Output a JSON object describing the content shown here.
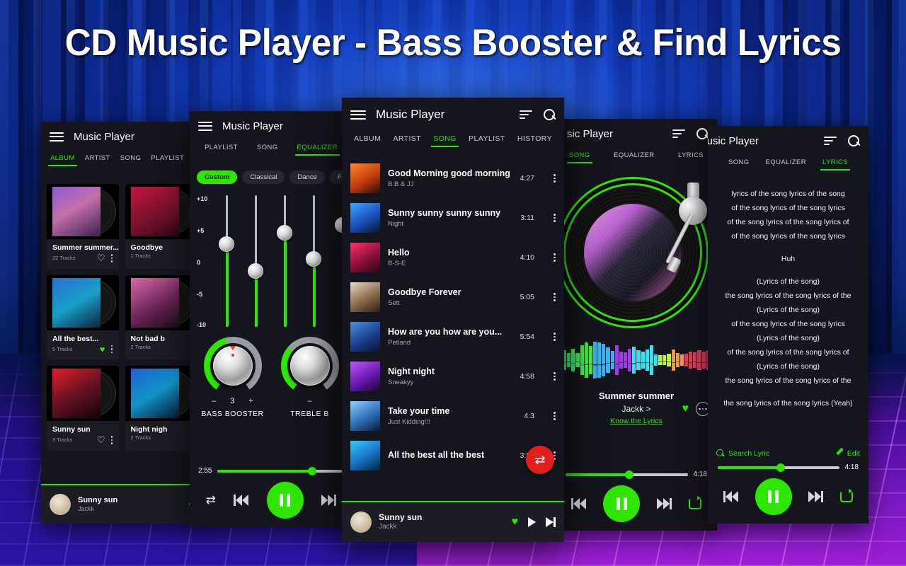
{
  "banner": {
    "title": "CD Music Player - Bass Booster & Find Lyrics"
  },
  "colors": {
    "accent": "#2ee600",
    "fab": "#e31e1e",
    "panel": "#15161d",
    "card": "#1b1c24"
  },
  "app": {
    "title": "Music Player"
  },
  "phone_album": {
    "title": "Music Player",
    "tabs": [
      {
        "label": "ALBUM",
        "active": true
      },
      {
        "label": "ARTIST",
        "active": false
      },
      {
        "label": "SONG",
        "active": false
      },
      {
        "label": "PLAYLIST",
        "active": false
      }
    ],
    "albums": [
      {
        "name": "Summer summer...",
        "tracks": "22 Tracks",
        "liked": false
      },
      {
        "name": "Goodbye",
        "tracks": "1 Tracks",
        "liked": false
      },
      {
        "name": "All the best...",
        "tracks": "5 Tracks",
        "liked": true
      },
      {
        "name": "Not bad b",
        "tracks": "2 Tracks",
        "liked": false
      },
      {
        "name": "Sunny sun",
        "tracks": "3 Tracks",
        "liked": false
      },
      {
        "name": "Night nigh",
        "tracks": "2 Tracks",
        "liked": false
      }
    ],
    "mini": {
      "title": "Sunny sun",
      "artist": "Jackk",
      "liked": true
    }
  },
  "phone_equalizer": {
    "title": "Music Player",
    "tabs": [
      {
        "label": "PLAYLIST",
        "active": false
      },
      {
        "label": "SONG",
        "active": false
      },
      {
        "label": "EQUALIZER",
        "active": true
      }
    ],
    "presets": [
      {
        "label": "Custom",
        "active": true
      },
      {
        "label": "Classical",
        "active": false
      },
      {
        "label": "Dance",
        "active": false
      },
      {
        "label": "Fl",
        "active": false
      }
    ],
    "scale": [
      "+10",
      "+5",
      "0",
      "-5",
      "-10"
    ],
    "bands": [
      2.5,
      -1.5,
      4.5,
      0.5,
      5.5
    ],
    "knobs": [
      {
        "label": "BASS BOOSTER",
        "value": "3",
        "minus": "–",
        "plus": "+"
      },
      {
        "label": "TREBLE B",
        "value": "",
        "minus": "–",
        "plus": ""
      }
    ],
    "seek": {
      "elapsed": "2:55",
      "progress_pct": 75
    }
  },
  "phone_songs": {
    "title": "Music Player",
    "tabs": [
      {
        "label": "ALBUM",
        "active": false
      },
      {
        "label": "ARTIST",
        "active": false
      },
      {
        "label": "SONG",
        "active": true
      },
      {
        "label": "PLAYLIST",
        "active": false
      },
      {
        "label": "HISTORY",
        "active": false
      }
    ],
    "songs": [
      {
        "title": "Good Morning good morning",
        "artist": "B.B & JJ",
        "duration": "4:27"
      },
      {
        "title": "Sunny sunny sunny sunny",
        "artist": "Night",
        "duration": "3:11"
      },
      {
        "title": "Hello",
        "artist": "B-S-E",
        "duration": "4:10"
      },
      {
        "title": "Goodbye Forever",
        "artist": "Sett",
        "duration": "5:05"
      },
      {
        "title": "How are you how are you...",
        "artist": "Petland",
        "duration": "5:54"
      },
      {
        "title": "Night night",
        "artist": "Sneakyy",
        "duration": "4:58"
      },
      {
        "title": "Take your time",
        "artist": "Just Kidding!!!",
        "duration": "4:3"
      },
      {
        "title": "All the best all the best",
        "artist": "",
        "duration": "3:54"
      }
    ],
    "fab_icon": "shuffle-icon",
    "mini": {
      "title": "Sunny sun",
      "artist": "Jackk",
      "liked": true
    }
  },
  "phone_nowplaying": {
    "title": "sic Player",
    "tabs": [
      {
        "label": "SONG",
        "active": true
      },
      {
        "label": "EQUALIZER",
        "active": false
      },
      {
        "label": "LYRICS",
        "active": false
      }
    ],
    "now": {
      "title": "Summer summer",
      "artist": "Jackk >",
      "lyrics_link": "Know the Lyrics",
      "liked": true
    },
    "seek": {
      "remaining": "4:18",
      "progress_pct": 52
    },
    "spectrum": [
      55,
      38,
      62,
      40,
      80,
      95,
      78,
      100,
      98,
      88,
      70,
      50,
      82,
      46,
      44,
      60,
      72,
      52,
      48,
      58,
      80,
      30,
      26,
      28,
      34,
      56,
      40,
      30,
      36,
      46,
      42,
      52,
      48,
      54
    ]
  },
  "phone_lyrics": {
    "title": "Music Player",
    "tabs": [
      {
        "label": "SONG",
        "active": false
      },
      {
        "label": "EQUALIZER",
        "active": false
      },
      {
        "label": "LYRICS",
        "active": true
      }
    ],
    "lines": [
      "lyrics of the song lyrics of the song",
      "of the song lyrics of the song lyrics",
      "of the song lyrics of the song lyrics of",
      "of the song lyrics of the song lyrics",
      "",
      "Huh",
      "",
      "(Lyrics of the song)",
      "the song lyrics of the song lyrics of the",
      "(Lyrics of the song)",
      "of the song lyrics of the song lyrics",
      "(Lyrics of the song)",
      "of the song lyrics of the song lyrics of",
      "(Lyrics of the song)",
      "the song lyrics of the song lyrics of the",
      "",
      "the song lyrics of the song lyrics (Yeah)"
    ],
    "actions": {
      "search": "Search Lyric",
      "edit": "Edit"
    },
    "seek": {
      "remaining": "4:18",
      "progress_pct": 52
    }
  }
}
